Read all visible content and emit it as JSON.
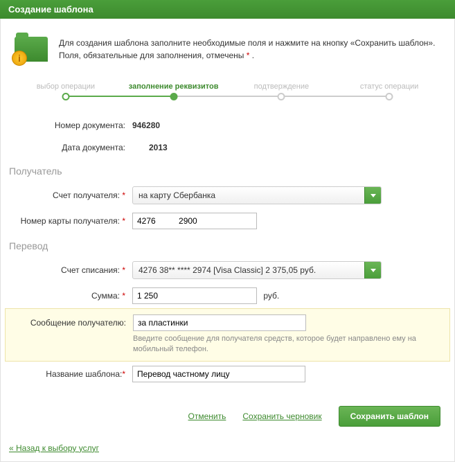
{
  "header": {
    "title": "Создание шаблона"
  },
  "info": {
    "line1": "Для создания шаблона заполните необходимые поля и нажмите на кнопку «Сохранить шаблон».",
    "line2a": "Поля, обязательные для заполнения, отмечены ",
    "line2b": " ."
  },
  "steps": {
    "s1": "выбор операции",
    "s2": "заполнение реквизитов",
    "s3": "подтверждение",
    "s4": "статус операции"
  },
  "form": {
    "doc_num_label": "Номер документа:",
    "doc_num_value": "946280",
    "doc_date_label": "Дата документа:",
    "doc_date_value": "2013",
    "recipient_section": "Получатель",
    "recipient_acct_label": "Счет получателя:",
    "recipient_acct_value": "на карту Сбербанка",
    "recipient_card_label": "Номер карты получателя:",
    "recipient_card_value": "4276          2900",
    "transfer_section": "Перевод",
    "debit_acct_label": "Счет списания:",
    "debit_acct_value": "4276 38** **** 2974  [Visa Classic] 2 375,05  руб.",
    "amount_label": "Сумма:",
    "amount_value": "1 250",
    "amount_unit": "руб.",
    "message_label": "Сообщение получателю:",
    "message_value": "за пластинки",
    "message_hint": "Введите сообщение для получателя средств, которое будет направлено ему на мобильный телефон.",
    "template_name_label": "Название шаблона:",
    "template_name_value": "Перевод частному лицу"
  },
  "actions": {
    "cancel": "Отменить",
    "save_draft": "Сохранить черновик",
    "save_template": "Сохранить шаблон"
  },
  "back_link": "« Назад к выбору услуг"
}
